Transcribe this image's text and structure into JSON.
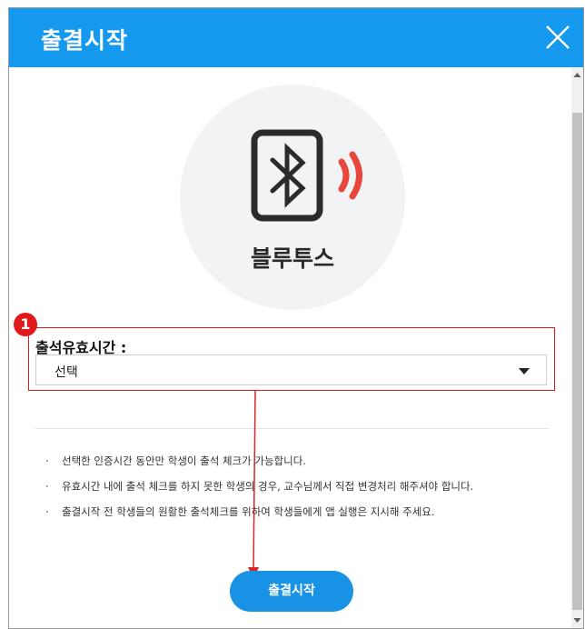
{
  "dialog": {
    "title": "출결시작",
    "close_icon": "close-icon",
    "method": {
      "icon": "bluetooth-phone-icon",
      "label": "블루투스",
      "signal_color": "#e8473d"
    },
    "step_badge": "1",
    "valid_time": {
      "label": "출석유효시간 :",
      "selected": "선택"
    },
    "notes": [
      "선택한 인증시간 동안만 학생이 출석 체크가 가능합니다.",
      "유효시간 내에 출석 체크를 하지 못한 학생의 경우, 교수님께서 직접 변경처리 해주셔야 합니다.",
      "출결시작 전 학생들의 원활한 출석체크를 위하여 학생들에게 앱 실행은 지시해 주세요."
    ],
    "bullet": "·",
    "start_button": "출결시작",
    "colors": {
      "header": "#1499ef",
      "button": "#1892e5",
      "highlight": "#e01a1a"
    }
  }
}
